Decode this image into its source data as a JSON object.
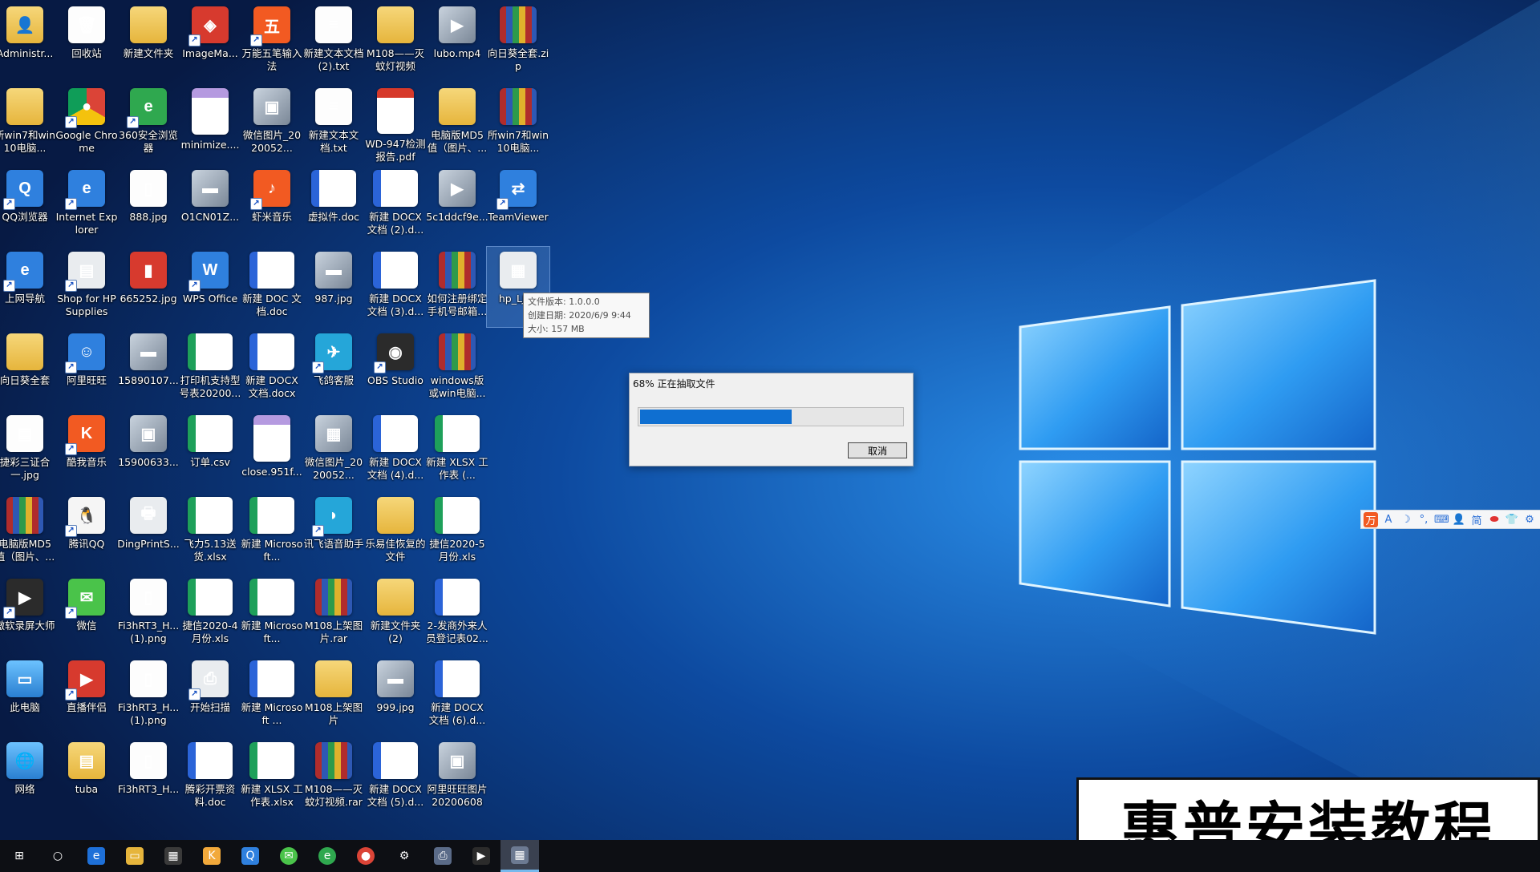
{
  "desktop": {
    "icons": [
      {
        "label": "Administr...",
        "type": "g-folder",
        "glyph": "👤",
        "shortcut": false
      },
      {
        "label": "回收站",
        "type": "g-file",
        "glyph": "🗑",
        "shortcut": false
      },
      {
        "label": "新建文件夹",
        "type": "g-folder",
        "glyph": "",
        "shortcut": false
      },
      {
        "label": "ImageMa...",
        "type": "g-app-red",
        "glyph": "◈",
        "shortcut": true
      },
      {
        "label": "万能五笔输入法",
        "type": "g-app-orange",
        "glyph": "五",
        "shortcut": true
      },
      {
        "label": "新建文本文档 (2).txt",
        "type": "g-file",
        "glyph": "≡",
        "shortcut": false
      },
      {
        "label": "M108——灭蚊灯视频",
        "type": "g-folder",
        "glyph": "",
        "shortcut": false
      },
      {
        "label": "lubo.mp4",
        "type": "g-img",
        "glyph": "▶",
        "shortcut": false
      },
      {
        "label": "向日葵全套.zip",
        "type": "g-rar",
        "glyph": "",
        "shortcut": false
      },
      {
        "label": "所win7和win10电脑...",
        "type": "g-folder",
        "glyph": "",
        "shortcut": false
      },
      {
        "label": "Google Chrome",
        "type": "g-chrome",
        "glyph": "●",
        "shortcut": true
      },
      {
        "label": "360安全浏览器",
        "type": "g-app-green",
        "glyph": "e",
        "shortcut": true
      },
      {
        "label": "minimize....",
        "type": "g-svg",
        "glyph": "SVG",
        "shortcut": false
      },
      {
        "label": "微信图片_2020052...",
        "type": "g-img",
        "glyph": "▣",
        "shortcut": false
      },
      {
        "label": "新建文本文档.txt",
        "type": "g-file",
        "glyph": "≡",
        "shortcut": false
      },
      {
        "label": "WD-947检测报告.pdf",
        "type": "g-pdf",
        "glyph": "PDF",
        "shortcut": false
      },
      {
        "label": "电脑版MD5值（图片、...",
        "type": "g-folder",
        "glyph": "",
        "shortcut": false
      },
      {
        "label": "所win7和win10电脑...",
        "type": "g-rar",
        "glyph": "",
        "shortcut": false
      },
      {
        "label": "QQ浏览器",
        "type": "g-app-blue",
        "glyph": "Q",
        "shortcut": true
      },
      {
        "label": "Internet Explorer",
        "type": "g-app-blue",
        "glyph": "e",
        "shortcut": true
      },
      {
        "label": "888.jpg",
        "type": "g-file",
        "glyph": "▯",
        "shortcut": false
      },
      {
        "label": "O1CN01Z...",
        "type": "g-img",
        "glyph": "▬",
        "shortcut": false
      },
      {
        "label": "虾米音乐",
        "type": "g-app-orange",
        "glyph": "♪",
        "shortcut": true
      },
      {
        "label": "虚拟件.doc",
        "type": "g-word",
        "glyph": "W",
        "shortcut": false
      },
      {
        "label": "新建 DOCX 文档 (2).d...",
        "type": "g-word",
        "glyph": "W",
        "shortcut": false
      },
      {
        "label": "5c1ddcf9e...",
        "type": "g-img",
        "glyph": "▶",
        "shortcut": false
      },
      {
        "label": "TeamViewer",
        "type": "g-app-blue",
        "glyph": "⇄",
        "shortcut": true
      },
      {
        "label": "上网导航",
        "type": "g-app-blue",
        "glyph": "e",
        "shortcut": true
      },
      {
        "label": "Shop for HP Supplies",
        "type": "g-app-gray",
        "glyph": "▤",
        "shortcut": true
      },
      {
        "label": "665252.jpg",
        "type": "g-app-red",
        "glyph": "▮",
        "shortcut": false
      },
      {
        "label": "WPS Office",
        "type": "g-app-blue",
        "glyph": "W",
        "shortcut": true
      },
      {
        "label": "新建 DOC 文档.doc",
        "type": "g-word",
        "glyph": "W",
        "shortcut": false
      },
      {
        "label": "987.jpg",
        "type": "g-img",
        "glyph": "▬",
        "shortcut": false
      },
      {
        "label": "新建 DOCX 文档 (3).d...",
        "type": "g-word",
        "glyph": "W",
        "shortcut": false
      },
      {
        "label": "如何注册绑定手机号邮箱...",
        "type": "g-rar",
        "glyph": "",
        "shortcut": false
      },
      {
        "label": "hp_LJP1",
        "type": "g-app-gray",
        "glyph": "▦",
        "shortcut": false
      },
      {
        "label": "向日葵全套",
        "type": "g-folder",
        "glyph": "",
        "shortcut": false
      },
      {
        "label": "阿里旺旺",
        "type": "g-app-blue",
        "glyph": "☺",
        "shortcut": true
      },
      {
        "label": "15890107...",
        "type": "g-img",
        "glyph": "▬",
        "shortcut": false
      },
      {
        "label": "打印机支持型号表20200...",
        "type": "g-excel",
        "glyph": "S",
        "shortcut": false
      },
      {
        "label": "新建 DOCX 文档.docx",
        "type": "g-word",
        "glyph": "W",
        "shortcut": false
      },
      {
        "label": "飞鸽客服",
        "type": "g-app-cyan",
        "glyph": "✈",
        "shortcut": true
      },
      {
        "label": "OBS Studio",
        "type": "g-app-dark",
        "glyph": "◉",
        "shortcut": true
      },
      {
        "label": "windows版或win电脑...",
        "type": "g-rar",
        "glyph": "",
        "shortcut": false
      },
      {
        "label": "捷彩三证合一.jpg",
        "type": "g-file",
        "glyph": "▤",
        "shortcut": false
      },
      {
        "label": "酷我音乐",
        "type": "g-app-orange",
        "glyph": "K",
        "shortcut": true
      },
      {
        "label": "15900633...",
        "type": "g-img",
        "glyph": "▣",
        "shortcut": false
      },
      {
        "label": "订单.csv",
        "type": "g-excel",
        "glyph": "S",
        "shortcut": false
      },
      {
        "label": "close.951f...",
        "type": "g-svg",
        "glyph": "SVG",
        "shortcut": false
      },
      {
        "label": "微信图片_2020052...",
        "type": "g-img",
        "glyph": "▦",
        "shortcut": false
      },
      {
        "label": "新建 DOCX 文档 (4).d...",
        "type": "g-word",
        "glyph": "W",
        "shortcut": false
      },
      {
        "label": "新建 XLSX 工作表 (...",
        "type": "g-excel",
        "glyph": "S",
        "shortcut": false
      },
      {
        "label": "电脑版MD5值（图片、...",
        "type": "g-rar",
        "glyph": "",
        "shortcut": false
      },
      {
        "label": "腾讯QQ",
        "type": "g-qq",
        "glyph": "🐧",
        "shortcut": true
      },
      {
        "label": "DingPrintS...",
        "type": "g-app-gray",
        "glyph": "🖶",
        "shortcut": false
      },
      {
        "label": "飞力5.13送货.xlsx",
        "type": "g-excel",
        "glyph": "S",
        "shortcut": false
      },
      {
        "label": "新建 Microsoft...",
        "type": "g-excel",
        "glyph": "S",
        "shortcut": false
      },
      {
        "label": "讯飞语音助手",
        "type": "g-app-cyan",
        "glyph": "◗",
        "shortcut": true
      },
      {
        "label": "乐易佳恢复的文件",
        "type": "g-folder",
        "glyph": "",
        "shortcut": false
      },
      {
        "label": "捷信2020-5月份.xls",
        "type": "g-excel",
        "glyph": "S",
        "shortcut": false
      },
      {
        "label": "傲软录屏大师",
        "type": "g-app-dark",
        "glyph": "▶",
        "shortcut": true
      },
      {
        "label": "微信",
        "type": "g-wechat",
        "glyph": "✉",
        "shortcut": true
      },
      {
        "label": "Fi3hRT3_H... (1).png",
        "type": "g-file",
        "glyph": "▯",
        "shortcut": false
      },
      {
        "label": "捷信2020-4月份.xls",
        "type": "g-excel",
        "glyph": "S",
        "shortcut": false
      },
      {
        "label": "新建 Microsoft...",
        "type": "g-excel",
        "glyph": "S",
        "shortcut": false
      },
      {
        "label": "M108上架图片.rar",
        "type": "g-rar",
        "glyph": "",
        "shortcut": false
      },
      {
        "label": "新建文件夹 (2)",
        "type": "g-folder",
        "glyph": "",
        "shortcut": false
      },
      {
        "label": "2-发商外来人员登记表02...",
        "type": "g-word",
        "glyph": "W",
        "shortcut": false
      },
      {
        "label": "此电脑",
        "type": "g-pc",
        "glyph": "▭",
        "shortcut": false
      },
      {
        "label": "直播伴侣",
        "type": "g-app-red",
        "glyph": "▶",
        "shortcut": true
      },
      {
        "label": "Fi3hRT3_H... (1).png",
        "type": "g-file",
        "glyph": "▯",
        "shortcut": false
      },
      {
        "label": "开始扫描",
        "type": "g-app-gray",
        "glyph": "⎙",
        "shortcut": true
      },
      {
        "label": "新建 Microsoft ...",
        "type": "g-word",
        "glyph": "W",
        "shortcut": false
      },
      {
        "label": "M108上架图片",
        "type": "g-folder",
        "glyph": "",
        "shortcut": false
      },
      {
        "label": "999.jpg",
        "type": "g-img",
        "glyph": "▬",
        "shortcut": false
      },
      {
        "label": "新建 DOCX 文档 (6).d...",
        "type": "g-word",
        "glyph": "W",
        "shortcut": false
      },
      {
        "label": "网络",
        "type": "g-pc",
        "glyph": "🌐",
        "shortcut": false
      },
      {
        "label": "tuba",
        "type": "g-folder",
        "glyph": "▤",
        "shortcut": false
      },
      {
        "label": "Fi3hRT3_H...",
        "type": "g-file",
        "glyph": "▯",
        "shortcut": false
      },
      {
        "label": "腾彩开票资料.doc",
        "type": "g-word",
        "glyph": "W",
        "shortcut": false
      },
      {
        "label": "新建 XLSX 工作表.xlsx",
        "type": "g-excel",
        "glyph": "S",
        "shortcut": false
      },
      {
        "label": "M108——灭蚊灯视频.rar",
        "type": "g-rar",
        "glyph": "",
        "shortcut": false
      },
      {
        "label": "新建 DOCX 文档 (5).d...",
        "type": "g-word",
        "glyph": "W",
        "shortcut": false
      },
      {
        "label": "阿里旺旺图片202006081...",
        "type": "g-img",
        "glyph": "▣",
        "shortcut": false
      }
    ]
  },
  "tooltip": {
    "lines": [
      "文件版本: 1.0.0.0",
      "创建日期: 2020/6/9 9:44",
      "大小: 157 MB"
    ]
  },
  "progress_dialog": {
    "title": "68% 正在抽取文件",
    "progress_fraction": 0.58,
    "cancel_label": "取消"
  },
  "ime_toolbar": {
    "items": [
      "万",
      "A",
      "☽",
      "°,",
      "⌨",
      "👤",
      "简",
      "⬬",
      "👕",
      "⚙"
    ]
  },
  "watermark": {
    "text": "惠普安装教程"
  },
  "taskbar": {
    "items": [
      {
        "name": "start-button",
        "glyph": "⊞",
        "color": "#ffffff",
        "bg": "transparent"
      },
      {
        "name": "cortana-button",
        "glyph": "○",
        "color": "#ffffff",
        "bg": "transparent"
      },
      {
        "name": "edge-taskbar",
        "glyph": "e",
        "color": "#ffffff",
        "bg": "#1e70d8"
      },
      {
        "name": "explorer-taskbar",
        "glyph": "▭",
        "color": "#ffffff",
        "bg": "#e6b53c"
      },
      {
        "name": "store-taskbar",
        "glyph": "▦",
        "color": "#ffffff",
        "bg": "#3a3a3a"
      },
      {
        "name": "kuwo-taskbar",
        "glyph": "K",
        "color": "#ffffff",
        "bg": "#f2a93b"
      },
      {
        "name": "qqbrowser-taskbar",
        "glyph": "Q",
        "color": "#ffffff",
        "bg": "#2f80de"
      },
      {
        "name": "wechat-taskbar",
        "glyph": "✉",
        "color": "#ffffff",
        "bg": "#4ac34a"
      },
      {
        "name": "360-taskbar",
        "glyph": "e",
        "color": "#ffffff",
        "bg": "#2fa84f"
      },
      {
        "name": "chrome-taskbar",
        "glyph": "●",
        "color": "#ffffff",
        "bg": "#db4437"
      },
      {
        "name": "settings-taskbar",
        "glyph": "⚙",
        "color": "#ffffff",
        "bg": "transparent"
      },
      {
        "name": "printer-taskbar",
        "glyph": "⎙",
        "color": "#ffffff",
        "bg": "#5a6b88"
      },
      {
        "name": "recorder-taskbar",
        "glyph": "▶",
        "color": "#ffffff",
        "bg": "#2b2b2b"
      },
      {
        "name": "installer-taskbar",
        "glyph": "▦",
        "color": "#ffffff",
        "bg": "#6c7a92"
      }
    ],
    "active_index": 13
  }
}
